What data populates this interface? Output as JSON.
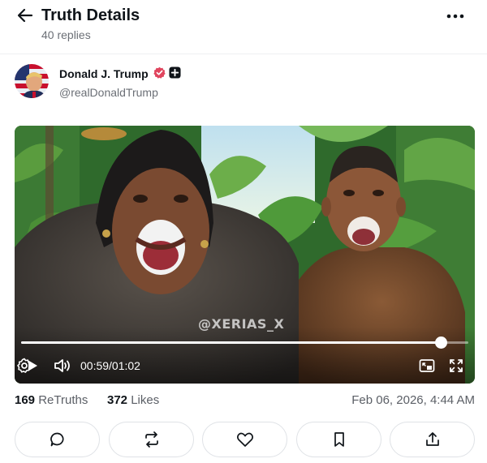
{
  "header": {
    "title": "Truth Details",
    "replies": "40 replies"
  },
  "author": {
    "name": "Donald J. Trump",
    "handle": "@realDonaldTrump",
    "verified_color": "#e0455e"
  },
  "video": {
    "watermark": "@XERIAS_X",
    "time": "00:59/01:02",
    "progress": 0.938
  },
  "stats": {
    "retruths_count": "169",
    "retruths_label": "ReTruths",
    "likes_count": "372",
    "likes_label": "Likes",
    "date": "Feb 06, 2026, 4:44 AM"
  },
  "actions": [
    "comment-icon",
    "retruth-icon",
    "like-icon",
    "bookmark-icon",
    "share-icon"
  ],
  "colors": {
    "text": "#0f1419",
    "muted": "#6b6f76",
    "border": "#dfe2e6"
  }
}
